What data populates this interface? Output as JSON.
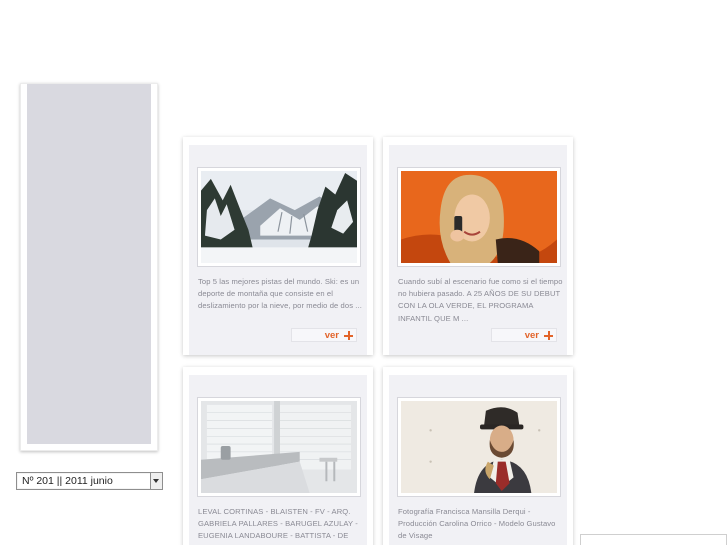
{
  "issue_selector": {
    "selected": "Nº 201 || 2011 junio"
  },
  "articles": [
    {
      "image": "mountain-ski-slopes-photo",
      "excerpt": "Top 5 las mejores pistas del mundo. Ski: es un deporte de montaña que consiste en el deslizamiento por la nieve, por medio de dos ...",
      "more_label": "ver"
    },
    {
      "image": "smiling-woman-phone-photo",
      "excerpt": "Cuando subí al escenario fue como si el tiempo no hubiera pasado. A 25 AÑOS DE SU DEBUT CON LA OLA VERDE, EL PROGRAMA INFANTIL QUE M ...",
      "more_label": "ver"
    },
    {
      "image": "kitchen-window-blinds-photo",
      "excerpt": "LEVAL CORTINAS - BLAISTEN - FV - ARQ. GABRIELA PALLARES - BARUGEL AZULAY - EUGENIA LANDABOURE - BATTISTA - DE OTRO TIEMPO"
    },
    {
      "image": "man-in-hat-portrait-photo",
      "excerpt": "Fotografía Francisca Mansilla Derqui - Producción Carolina Orrico - Modelo Gustavo de Visage"
    }
  ],
  "colors": {
    "accent": "#e2642a",
    "panel": "#d9d9e0",
    "card_bg": "#f1f1f5",
    "excerpt_text": "#8a8a94"
  }
}
